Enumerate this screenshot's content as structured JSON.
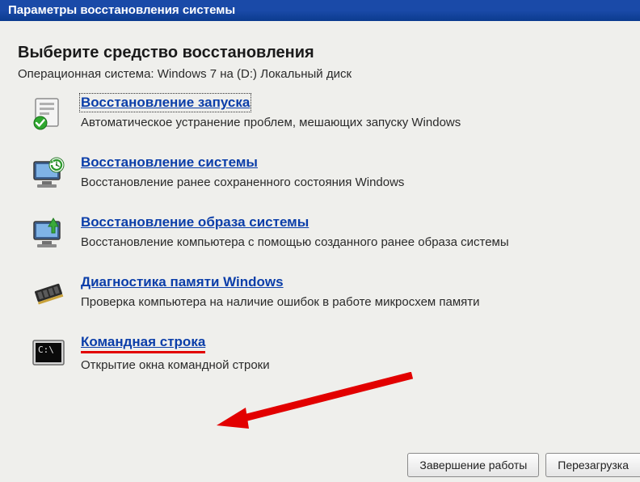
{
  "titlebar": {
    "title": "Параметры восстановления системы"
  },
  "section_title": "Выберите средство восстановления",
  "os_line": "Операционная система: Windows 7 на (D:) Локальный диск",
  "options": [
    {
      "link": "Восстановление запуска",
      "desc": "Автоматическое устранение проблем, мешающих запуску Windows"
    },
    {
      "link": "Восстановление системы",
      "desc": "Восстановление ранее сохраненного состояния Windows"
    },
    {
      "link": "Восстановление образа системы",
      "desc": "Восстановление компьютера с помощью  созданного ранее образа системы"
    },
    {
      "link": "Диагностика памяти Windows",
      "desc": "Проверка компьютера на наличие ошибок в работе микросхем памяти"
    },
    {
      "link": "Командная строка",
      "desc": "Открытие окна командной строки"
    }
  ],
  "buttons": {
    "shutdown": "Завершение работы",
    "restart": "Перезагрузка"
  }
}
